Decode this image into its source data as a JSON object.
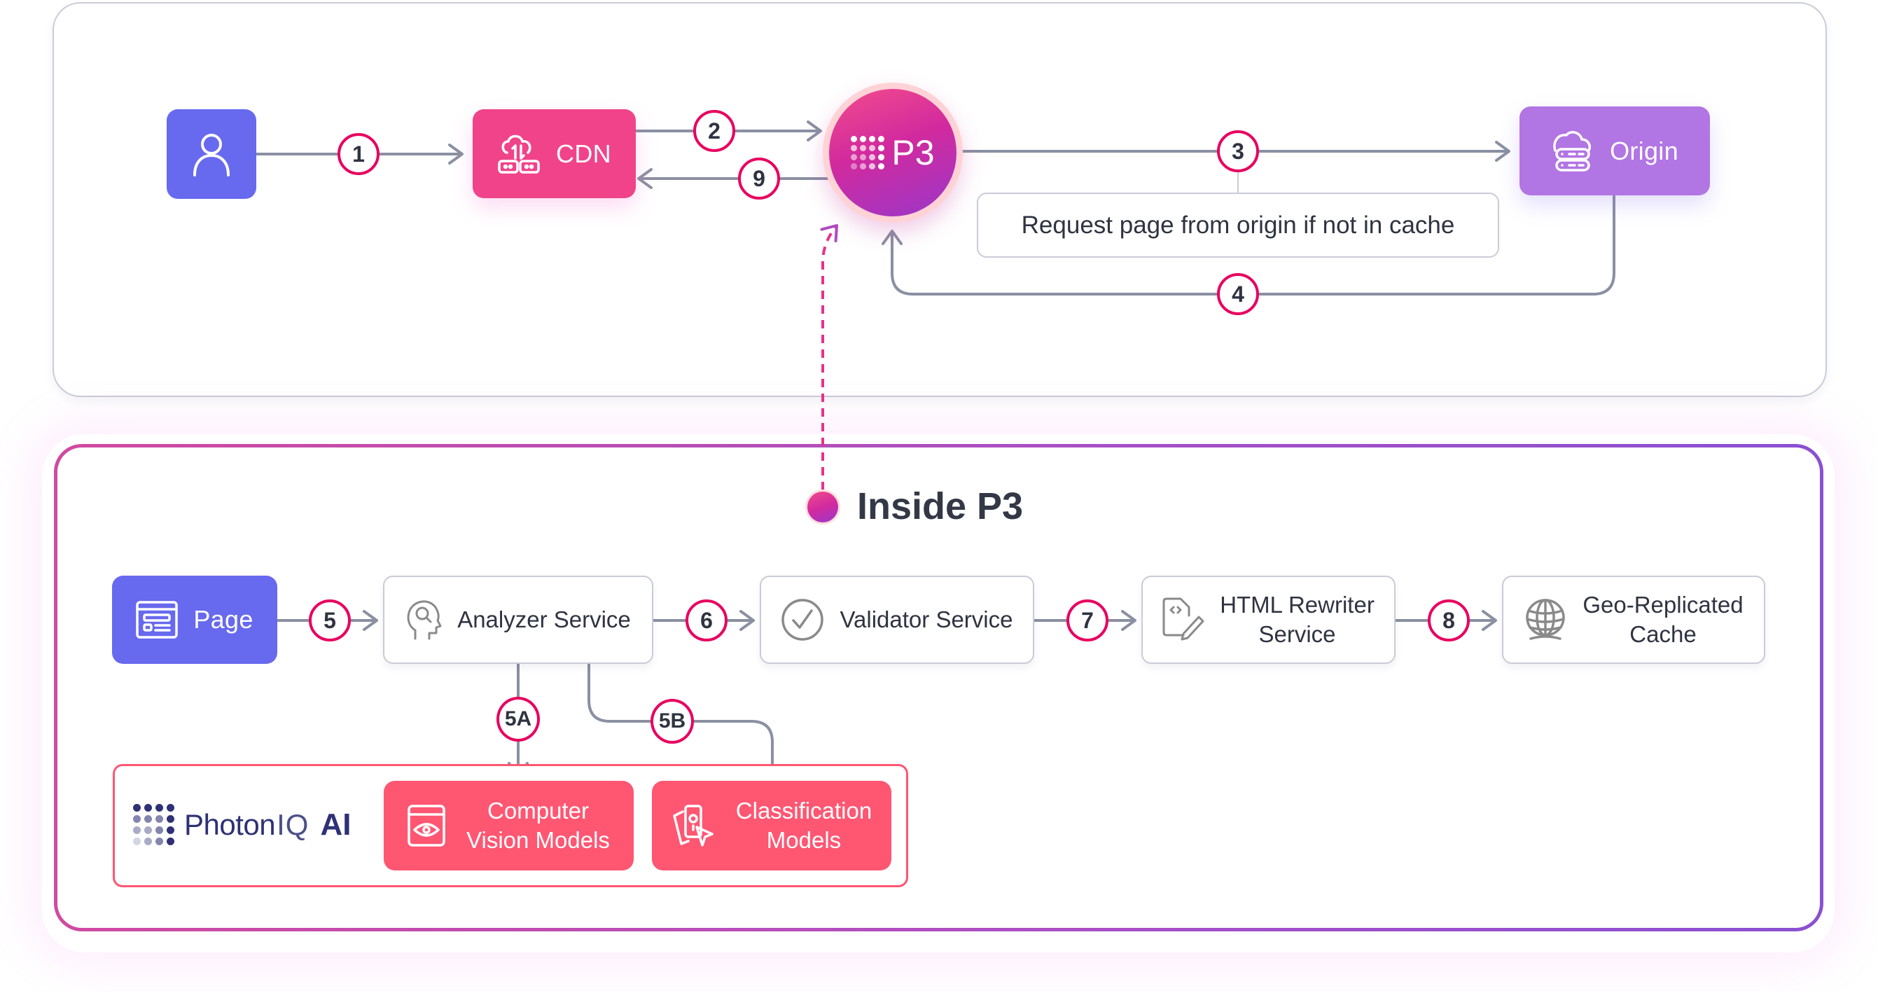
{
  "colors": {
    "user": "#6769ee",
    "cdn": "#f0438a",
    "origin": "#b275e4",
    "page": "#6769ee",
    "ai_model": "#ff5672",
    "badge_ring": "#e8005f",
    "connector": "#8a90a2",
    "dotted": "#e8308a",
    "brand_navy": "#2e3175"
  },
  "top_flow": {
    "user": {
      "icon": "user-icon"
    },
    "cdn": {
      "label": "CDN",
      "icon": "cloud-cdn-icon"
    },
    "p3": {
      "label": "P3",
      "icon": "p3-dots-icon"
    },
    "origin": {
      "label": "Origin",
      "icon": "cloud-server-icon"
    },
    "note": "Request page from origin if not in cache",
    "steps": [
      "1",
      "2",
      "9",
      "3",
      "4"
    ]
  },
  "inside": {
    "title": "Inside P3",
    "page": {
      "label": "Page",
      "icon": "webpage-icon"
    },
    "services": [
      {
        "label": "Analyzer Service",
        "icon": "head-search-icon"
      },
      {
        "label": "Validator Service",
        "icon": "check-circle-icon"
      },
      {
        "label": "HTML Rewriter Service",
        "line1": "HTML Rewriter",
        "line2": "Service",
        "icon": "code-edit-icon"
      },
      {
        "label": "Geo-Replicated Cache",
        "line1": "Geo-Replicated",
        "line2": "Cache",
        "icon": "globe-icon"
      }
    ],
    "steps": [
      "5",
      "6",
      "7",
      "8",
      "5A",
      "5B"
    ],
    "ai": {
      "brand_word1": "Photon",
      "brand_word2": "IQ",
      "brand_word3": "AI",
      "models": [
        {
          "line1": "Computer",
          "line2": "Vision Models",
          "icon": "eye-window-icon"
        },
        {
          "line1": "Classification",
          "line2": "Models",
          "icon": "cards-pointer-icon"
        }
      ]
    }
  }
}
